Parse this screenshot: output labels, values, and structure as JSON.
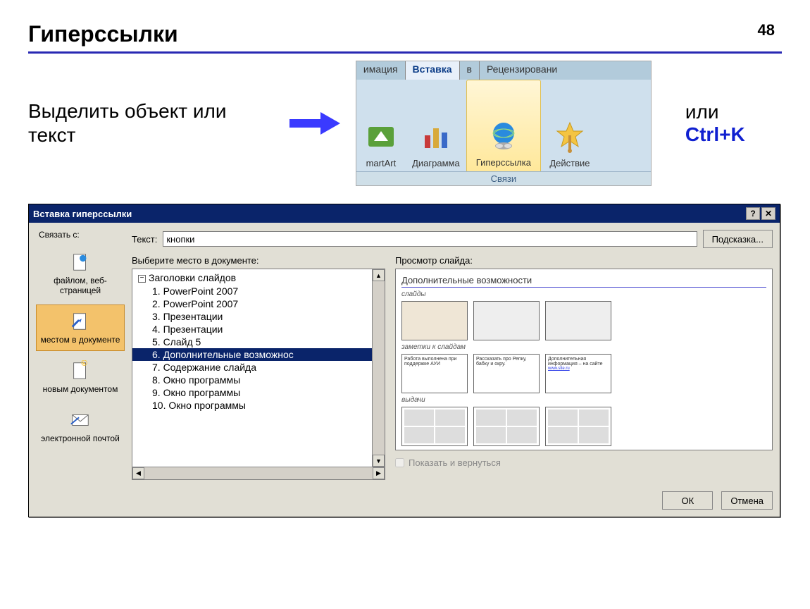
{
  "page_number": "48",
  "title": "Гиперссылки",
  "instruction": "Выделить объект или текст",
  "or_label": "или ",
  "shortcut": "Ctrl+K",
  "ribbon": {
    "tabs": {
      "animation": "имация",
      "insert": "Вставка",
      "v": "в",
      "review": "Рецензировани"
    },
    "items": {
      "smartart": "martArt",
      "chart": "Диаграмма",
      "hyperlink": "Гиперссылка",
      "action": "Действие"
    },
    "group_label": "Связи"
  },
  "dialog": {
    "title": "Вставка гиперссылки",
    "link_with_label": "Связать с:",
    "text_label": "Текст:",
    "text_value": "кнопки",
    "tooltip_btn": "Подсказка...",
    "sidebar": {
      "file": "файлом, веб-страницей",
      "place": "местом в документе",
      "newdoc": "новым документом",
      "email": "электронной почтой"
    },
    "select_place_label": "Выберите место в документе:",
    "tree_root": "Заголовки слайдов",
    "tree_items": [
      "1. PowerPoint 2007",
      "2. PowerPoint 2007",
      "3. Презентации",
      "4. Презентации",
      "5. Слайд 5",
      "6. Дополнительные возможнос",
      "7. Содержание слайда",
      "8. Окно программы",
      "9. Окно программы",
      "10. Окно программы"
    ],
    "selected_tree_index": 5,
    "preview_label": "Просмотр слайда:",
    "preview": {
      "title": "Дополнительные возможности",
      "section_slides": "слайды",
      "section_notes": "заметки к слайдам",
      "section_handouts": "выдачи",
      "note1": "Работа выполнена при поддержке АУИ",
      "note2": "Рассказать про Репку, бабку и окру.",
      "note3": "Дополнительная информация – на сайте"
    },
    "show_return_checkbox": "Показать и вернуться",
    "ok": "ОК",
    "cancel": "Отмена"
  }
}
